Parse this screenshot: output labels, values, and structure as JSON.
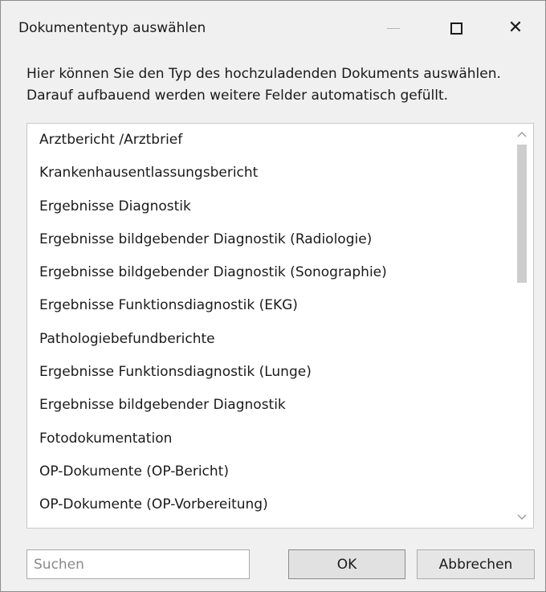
{
  "window": {
    "title": "Dokumententyp auswählen",
    "controls": {
      "minimize": "—",
      "maximize": "☐",
      "close": "✕"
    }
  },
  "description": {
    "line1": "Hier können Sie den Typ des hochzuladenden Dokuments auswählen.",
    "line2": "Darauf aufbauend werden weitere Felder automatisch gefüllt."
  },
  "list": {
    "items": [
      "Arztbericht /Arztbrief",
      "Krankenhausentlassungsbericht",
      "Ergebnisse Diagnostik",
      "Ergebnisse bildgebender Diagnostik  (Radiologie)",
      "Ergebnisse bildgebender Diagnostik  (Sonographie)",
      "Ergebnisse Funktionsdiagnostik (EKG)",
      "Pathologiebefundberichte",
      "Ergebnisse Funktionsdiagnostik (Lunge)",
      "Ergebnisse bildgebender Diagnostik",
      "Fotodokumentation",
      "OP-Dokumente (OP-Bericht)",
      "OP-Dokumente (OP-Vorbereitung)"
    ],
    "scroll_up_icon": "chevron-up-icon",
    "scroll_down_icon": "chevron-down-icon"
  },
  "search": {
    "placeholder": "Suchen",
    "value": ""
  },
  "buttons": {
    "ok": "OK",
    "cancel": "Abbrechen"
  }
}
